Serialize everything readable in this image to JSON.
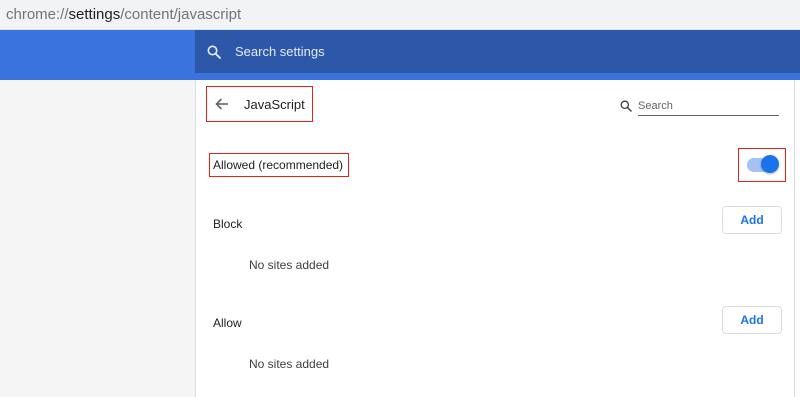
{
  "address": {
    "prefix": "chrome://",
    "host": "settings",
    "path": "/content/javascript"
  },
  "header": {
    "search_placeholder": "Search settings",
    "search_icon": "search-icon"
  },
  "page": {
    "title": "JavaScript",
    "back_icon": "arrow-left-icon",
    "search_placeholder": "Search"
  },
  "setting": {
    "label": "Allowed (recommended)",
    "enabled": true
  },
  "block": {
    "label": "Block",
    "add_label": "Add",
    "empty_text": "No sites added"
  },
  "allow": {
    "label": "Allow",
    "add_label": "Add",
    "empty_text": "No sites added"
  },
  "colors": {
    "header": "#3b73dc",
    "searchbar": "#2d57a8",
    "accent": "#1a73e8",
    "highlight": "#e2231a"
  }
}
